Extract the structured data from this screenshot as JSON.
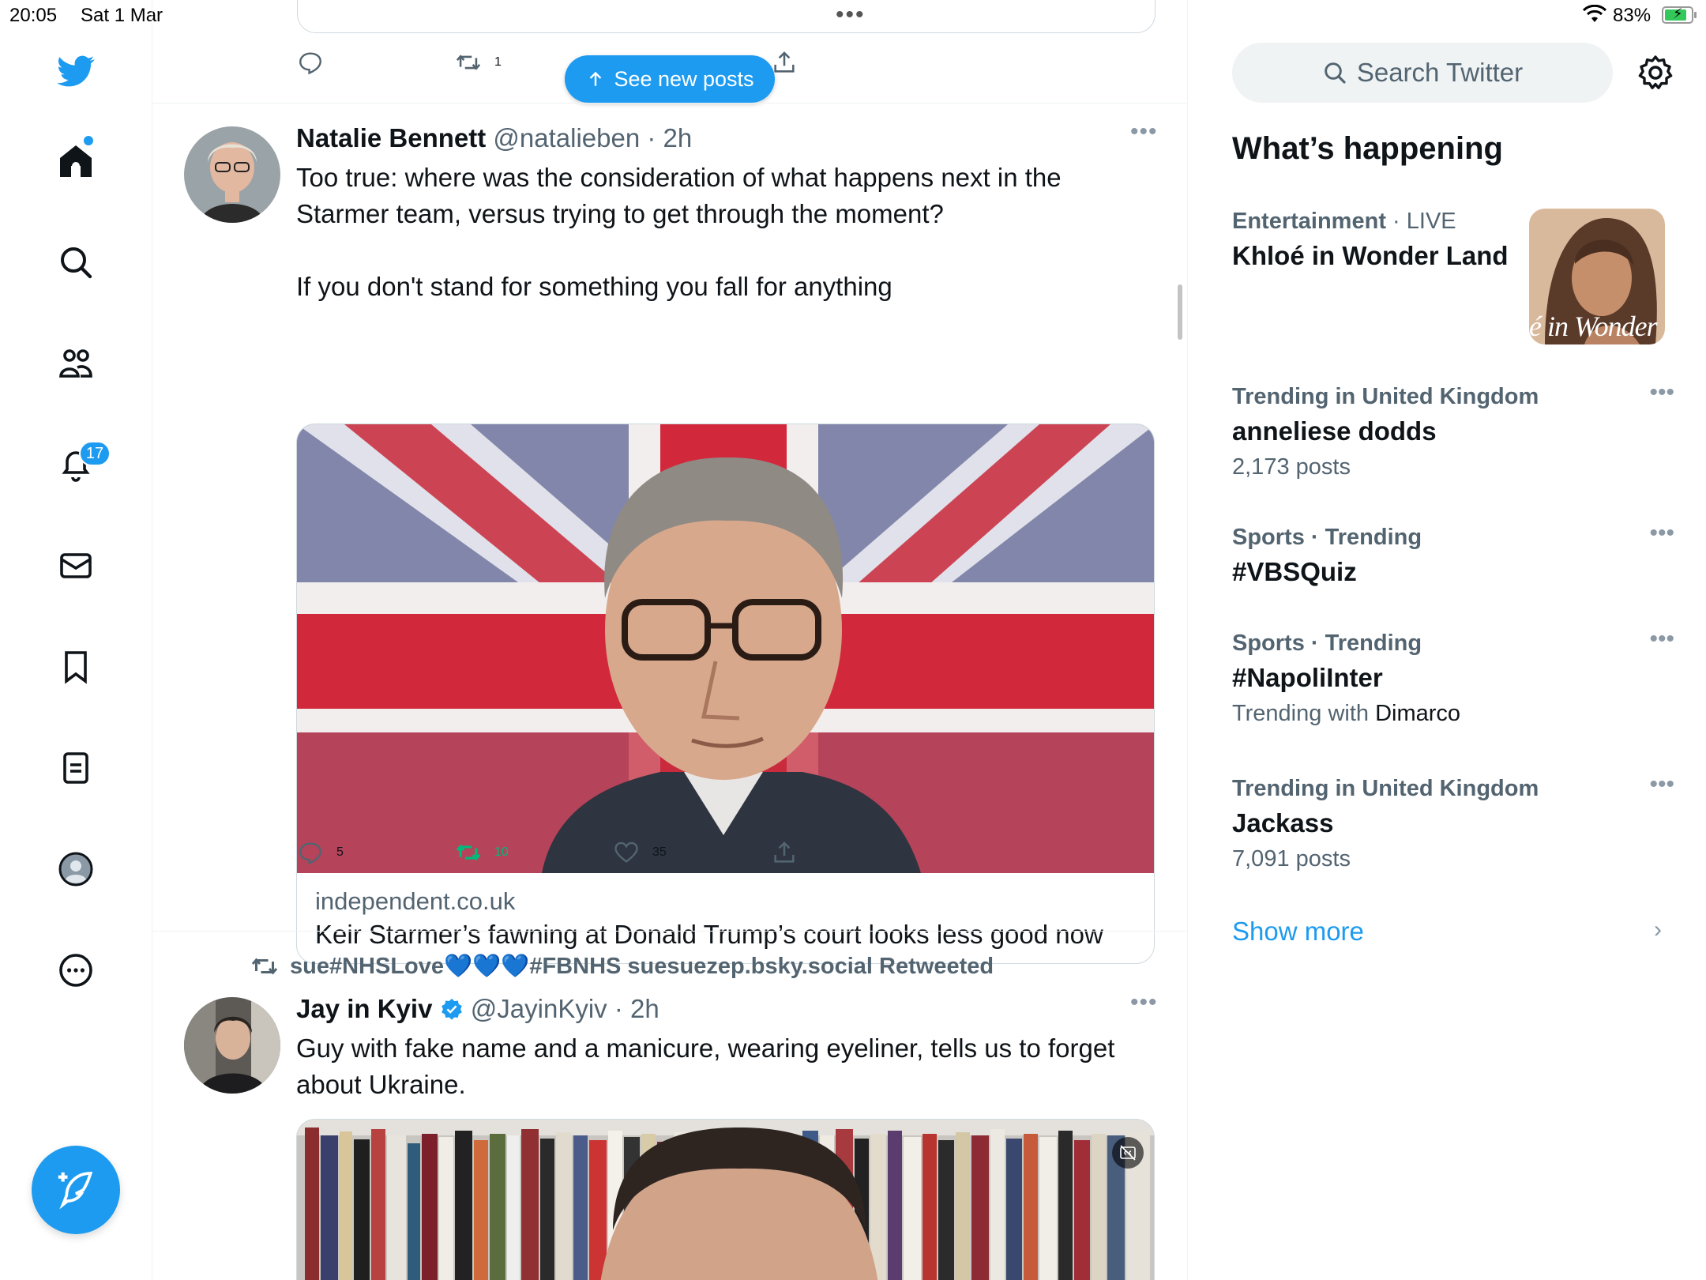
{
  "status_bar": {
    "time": "20:05",
    "date": "Sat 1 Mar",
    "battery_pct": "83%",
    "battery_level": 0.83
  },
  "nav": {
    "notifications_badge": "17",
    "items": [
      "twitter-logo",
      "home-icon",
      "search-icon",
      "communities-icon",
      "notifications-icon",
      "messages-icon",
      "bookmarks-icon",
      "lists-icon",
      "profile-icon",
      "more-icon"
    ]
  },
  "feed": {
    "top_actions": {
      "retweets": "1"
    },
    "see_new_posts": "See new posts",
    "tweets": [
      {
        "name": "Natalie Bennett",
        "handle": "@natalieben",
        "time": "· 2h",
        "text_line1": "Too true: where was the consideration of what happens next in the",
        "text_line2": "Starmer team, versus trying to get through the moment?",
        "text_line3": "If you don't stand for something you fall for anything",
        "card": {
          "domain": "independent.co.uk",
          "title": "Keir Starmer’s fawning at Donald Trump’s court looks less good now"
        },
        "replies": "5",
        "retweets": "10",
        "likes": "35"
      },
      {
        "retweeted_by": "sue#NHSLove💙💙💙#FBNHS suesuezep.bsky.social Retweeted",
        "name": "Jay in Kyiv",
        "handle": "@JayinKyiv",
        "time": "· 2h",
        "text_line1": "Guy with fake name and a manicure, wearing eyeliner, tells us to forget",
        "text_line2": "about Ukraine."
      }
    ]
  },
  "sidebar": {
    "search_placeholder": "Search Twitter",
    "whats_happening": "What’s happening",
    "trends": [
      {
        "context": "Entertainment",
        "live": "· LIVE",
        "title": "Khloé in Wonder Land",
        "thumb_text": "é in Wonder l"
      },
      {
        "context": "Trending in United Kingdom",
        "title": "anneliese dodds",
        "count": "2,173 posts"
      },
      {
        "context": "Sports · Trending",
        "title": "#VBSQuiz"
      },
      {
        "context": "Sports · Trending",
        "title": "#NapoliInter",
        "trending_with_label": "Trending with",
        "trending_with": "Dimarco"
      },
      {
        "context": "Trending in United Kingdom",
        "title": "Jackass",
        "count": "7,091 posts"
      }
    ],
    "show_more": "Show more"
  },
  "colors": {
    "accent": "#1d9bf0",
    "retweet_green": "#00ba7c",
    "muted": "#536471"
  }
}
